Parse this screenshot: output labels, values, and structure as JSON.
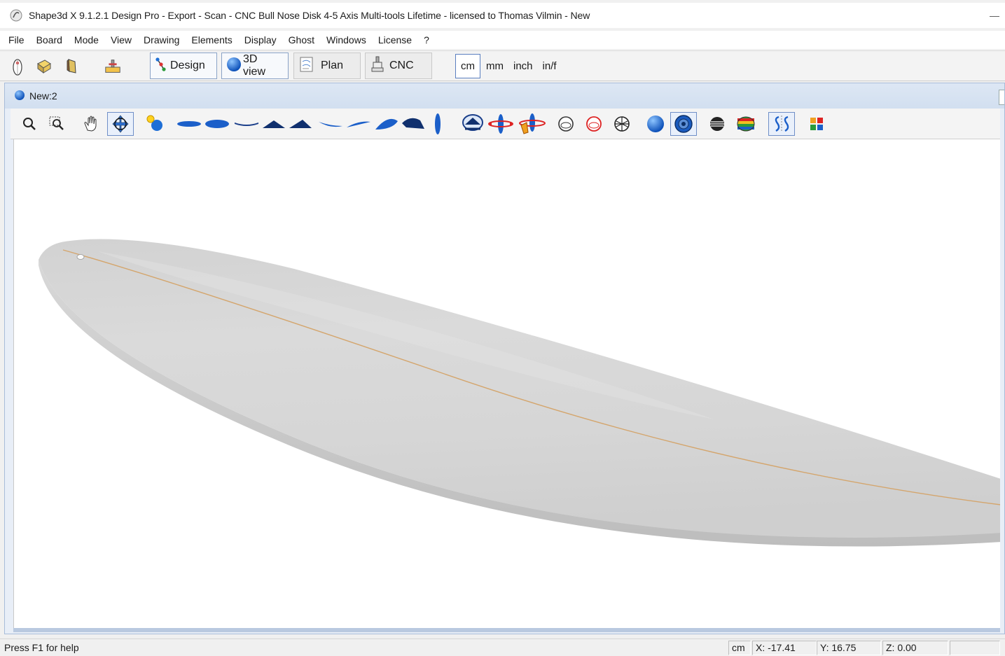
{
  "window": {
    "title": "Shape3d X 9.1.2.1 Design Pro - Export - Scan - CNC Bull Nose Disk 4-5 Axis Multi-tools Lifetime - licensed to Thomas Vilmin - New",
    "minimize_glyph": "—"
  },
  "menu": {
    "items": [
      "File",
      "Board",
      "Mode",
      "View",
      "Drawing",
      "Elements",
      "Display",
      "Ghost",
      "Windows",
      "License",
      "?"
    ]
  },
  "toolbar": {
    "icons": [
      "surfer-icon",
      "board-3d-icon",
      "deck-board-icon",
      "machine-icon"
    ],
    "modes": [
      {
        "label": "Design",
        "icon": "design-icon",
        "active": true
      },
      {
        "label": "3D view",
        "icon": "globe-icon",
        "active": true
      },
      {
        "label": "Plan",
        "icon": "plan-icon",
        "active": false
      },
      {
        "label": "CNC",
        "icon": "cnc-icon",
        "active": false
      }
    ],
    "units": [
      {
        "label": "cm",
        "selected": true
      },
      {
        "label": "mm",
        "selected": false
      },
      {
        "label": "inch",
        "selected": false
      },
      {
        "label": "in/f",
        "selected": false
      }
    ]
  },
  "document": {
    "title": "New:2",
    "view_tools": [
      "zoom-icon",
      "zoom-window-icon",
      "pan-hand-icon",
      "rotate-view-icon",
      "light-source-icon",
      "outline-view-1-icon",
      "outline-view-2-icon",
      "rocker-view-icon",
      "profile-view-1-icon",
      "profile-view-2-icon",
      "slice-view-1-icon",
      "slice-view-2-icon",
      "perspective-view-1-icon",
      "perspective-view-2-icon",
      "side-view-icon",
      "fit-view-icon",
      "rotate-axis-icon",
      "rotate-axis-red-icon",
      "sphere-outline-icon",
      "sphere-red-icon",
      "wireframe-sphere-icon",
      "shaded-blue-sphere-icon",
      "textured-sphere-icon",
      "striped-sphere-icon",
      "rainbow-sphere-icon",
      "symmetry-icon",
      "color-palette-icon"
    ],
    "selected_tools": [
      "rotate-view-icon",
      "textured-sphere-icon",
      "symmetry-icon"
    ]
  },
  "colors": {
    "board_fill": "#d9d9d9",
    "stringer": "#d4a56c",
    "accent_blue": "#1f6fd6",
    "selected_border": "#6f8fc7"
  },
  "status": {
    "help": "Press F1 for help",
    "unit": "cm",
    "x": "X: -17.41",
    "y": "Y: 16.75",
    "z": "Z: 0.00"
  }
}
